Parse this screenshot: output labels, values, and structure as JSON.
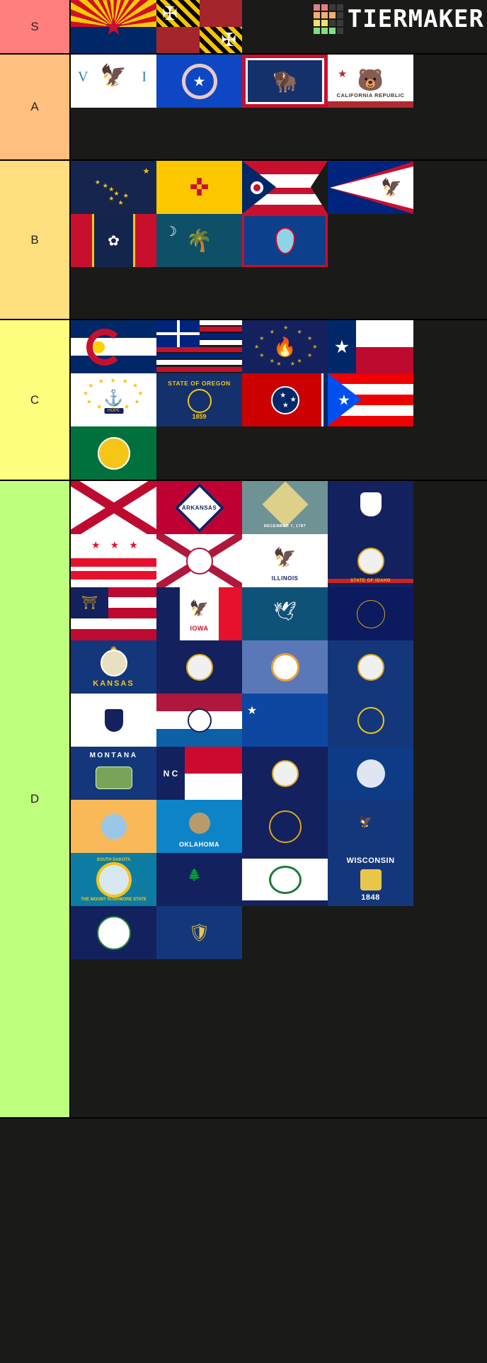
{
  "watermark": {
    "text": "TIERMAKER",
    "grid_colors": [
      "#e08080",
      "#e08080",
      "#3a3a3a",
      "#3a3a3a",
      "#f0b070",
      "#f0b070",
      "#f0b070",
      "#3a3a3a",
      "#f0e070",
      "#f0e070",
      "#3a3a3a",
      "#3a3a3a",
      "#80e080",
      "#80e080",
      "#80e080",
      "#3a3a3a"
    ]
  },
  "tier_colors": {
    "S": "#FF7F7F",
    "A": "#FFBF7F",
    "B": "#FFDF7F",
    "C": "#FFFF7F",
    "D": "#BFFF7F"
  },
  "tiers": [
    {
      "label": "S",
      "color": "#FF7F7F",
      "items": [
        {
          "name": "Arizona",
          "code": "az"
        },
        {
          "name": "Maryland",
          "code": "md"
        }
      ]
    },
    {
      "label": "A",
      "color": "#FFBF7F",
      "items": [
        {
          "name": "U.S. Virgin Islands",
          "code": "vi",
          "text": "V I"
        },
        {
          "name": "Northern Mariana Islands",
          "code": "mp"
        },
        {
          "name": "Wyoming",
          "code": "wy"
        },
        {
          "name": "California",
          "code": "ca",
          "text": "CALIFORNIA REPUBLIC"
        }
      ]
    },
    {
      "label": "B",
      "color": "#FFDF7F",
      "items": [
        {
          "name": "Alaska",
          "code": "ak"
        },
        {
          "name": "New Mexico",
          "code": "nm"
        },
        {
          "name": "Ohio",
          "code": "oh"
        },
        {
          "name": "American Samoa",
          "code": "as"
        },
        {
          "name": "Mississippi",
          "code": "ms"
        },
        {
          "name": "South Carolina",
          "code": "sc"
        },
        {
          "name": "Guam",
          "code": "gu"
        }
      ]
    },
    {
      "label": "C",
      "color": "#FFFF7F",
      "items": [
        {
          "name": "Colorado",
          "code": "co"
        },
        {
          "name": "Hawaii",
          "code": "hi"
        },
        {
          "name": "Indiana",
          "code": "in"
        },
        {
          "name": "Texas",
          "code": "tx"
        },
        {
          "name": "Rhode Island",
          "code": "ri",
          "text": "HOPE"
        },
        {
          "name": "Oregon",
          "code": "or",
          "text": "STATE OF OREGON",
          "year": "1859"
        },
        {
          "name": "Tennessee",
          "code": "tn"
        },
        {
          "name": "Puerto Rico",
          "code": "pr"
        },
        {
          "name": "Washington",
          "code": "wa"
        }
      ]
    },
    {
      "label": "D",
      "color": "#BFFF7F",
      "items": [
        {
          "name": "Alabama",
          "code": "al"
        },
        {
          "name": "Arkansas",
          "code": "ar",
          "text": "ARKANSAS"
        },
        {
          "name": "Delaware",
          "code": "de",
          "text": "DECEMBER 7, 1787"
        },
        {
          "name": "Connecticut",
          "code": "ct"
        },
        {
          "name": "District of Columbia",
          "code": "dc"
        },
        {
          "name": "Florida",
          "code": "fl"
        },
        {
          "name": "Illinois",
          "code": "il",
          "text": "ILLINOIS"
        },
        {
          "name": "Idaho",
          "code": "id",
          "text": "STATE OF IDAHO"
        },
        {
          "name": "Georgia",
          "code": "ga"
        },
        {
          "name": "Iowa",
          "code": "ia",
          "text": "IOWA"
        },
        {
          "name": "Louisiana",
          "code": "la"
        },
        {
          "name": "Kentucky",
          "code": "ky"
        },
        {
          "name": "Kansas",
          "code": "ks",
          "text": "KANSAS"
        },
        {
          "name": "Maine",
          "code": "me"
        },
        {
          "name": "Minnesota",
          "code": "mn"
        },
        {
          "name": "Michigan",
          "code": "mi"
        },
        {
          "name": "Massachusetts",
          "code": "ma"
        },
        {
          "name": "Missouri",
          "code": "mo"
        },
        {
          "name": "Nevada",
          "code": "nv"
        },
        {
          "name": "Nebraska",
          "code": "ne"
        },
        {
          "name": "Montana",
          "code": "mt",
          "text": "MONTANA"
        },
        {
          "name": "North Carolina",
          "code": "nc",
          "text": "N C"
        },
        {
          "name": "New Hampshire",
          "code": "nh"
        },
        {
          "name": "New York",
          "code": "ny"
        },
        {
          "name": "New Jersey",
          "code": "nj"
        },
        {
          "name": "Oklahoma",
          "code": "ok",
          "text": "OKLAHOMA"
        },
        {
          "name": "Utah",
          "code": "ut"
        },
        {
          "name": "North Dakota",
          "code": "nd"
        },
        {
          "name": "South Dakota",
          "code": "sd",
          "text": "SOUTH DAKOTA",
          "text2": "THE MOUNT RUSHMORE STATE"
        },
        {
          "name": "Vermont",
          "code": "vt"
        },
        {
          "name": "West Virginia",
          "code": "wv"
        },
        {
          "name": "Wisconsin",
          "code": "wi",
          "text": "WISCONSIN",
          "year": "1848"
        },
        {
          "name": "Virginia",
          "code": "va"
        },
        {
          "name": "Pennsylvania",
          "code": "pa"
        }
      ]
    }
  ]
}
